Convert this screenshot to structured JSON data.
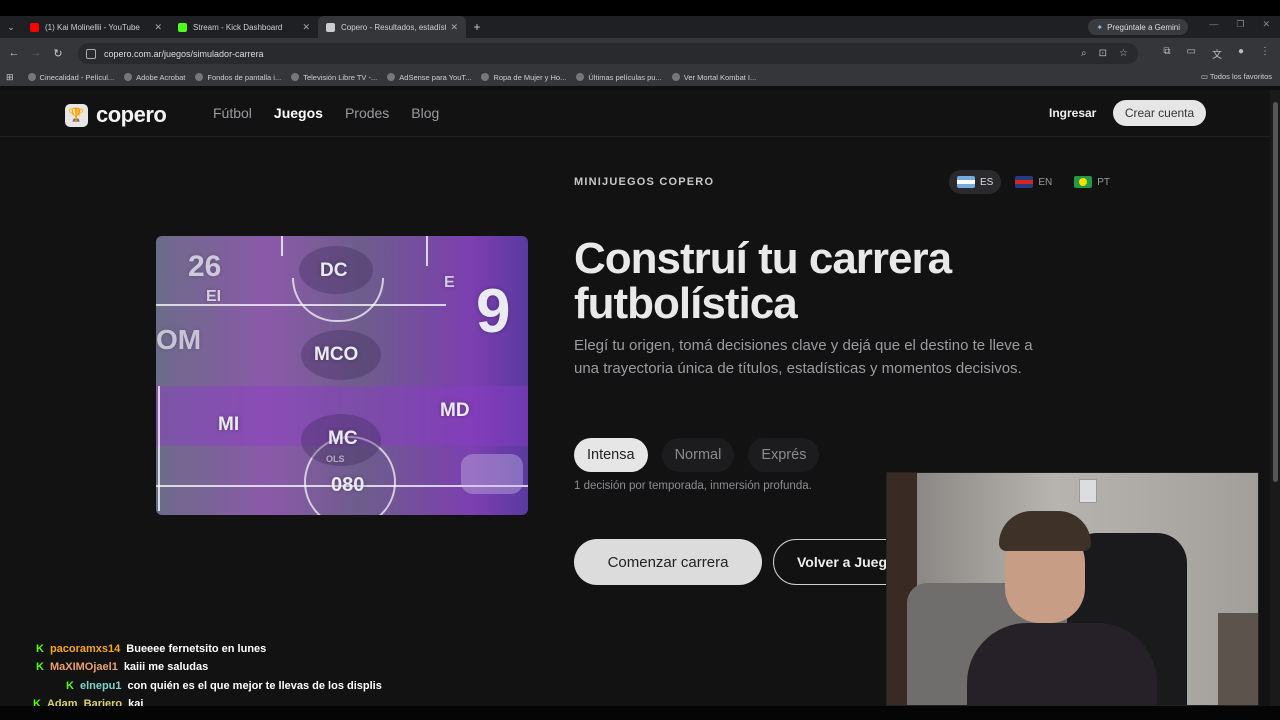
{
  "browser": {
    "tabs": [
      {
        "title": "(1) Kai Molinellii - YouTube",
        "icon": "youtube-icon",
        "color": "#ff0000"
      },
      {
        "title": "Stream - Kick Dashboard",
        "icon": "kick-icon",
        "color": "#53fc18"
      },
      {
        "title": "Copero - Resultados, estadístic",
        "icon": "copero-icon",
        "color": "#cccccc"
      }
    ],
    "gemini_label": "Pregúntale a Gemini",
    "url": "copero.com.ar/juegos/simulador-carrera",
    "bookmarks": [
      "Cinecalidad - Películ...",
      "Adobe Acrobat",
      "Fondos de pantalla i...",
      "Televisión Libre TV -...",
      "AdSense para YouT...",
      "Ropa de Mujer y Ho...",
      "Últimas películas pu...",
      "Ver Mortal Kombat I..."
    ],
    "all_bookmarks": "Todos los favoritos"
  },
  "site": {
    "logo": "copero",
    "nav": [
      "Fútbol",
      "Juegos",
      "Prodes",
      "Blog"
    ],
    "nav_current": "Juegos",
    "login": "Ingresar",
    "signup": "Crear cuenta"
  },
  "hero": {
    "eyebrow": "MINIJUEGOS COPERO",
    "languages": [
      {
        "code": "ES",
        "flag": "argentina-flag",
        "active": true
      },
      {
        "code": "EN",
        "flag": "uk-flag",
        "active": false
      },
      {
        "code": "PT",
        "flag": "brazil-flag",
        "active": false
      }
    ],
    "title": "Construí tu carrera futbolística",
    "description": "Elegí tu origen, tomá decisiones clave y dejá que el destino te lleve a una trayectoria única de títulos, estadísticas y momentos decisivos.",
    "modes": [
      "Intensa",
      "Normal",
      "Exprés"
    ],
    "selected_mode": "Intensa",
    "mode_hint": "1 decisión por temporada, inmersión profunda.",
    "start_button": "Comenzar carrera",
    "back_button": "Volver a Juegos",
    "image_positions": [
      "DC",
      "MCO",
      "MI",
      "MC",
      "MD",
      "26",
      "9",
      "080",
      "OLS",
      "EI",
      "E",
      "OM"
    ]
  },
  "chat": [
    {
      "user": "pacoramxs14",
      "text": "Bueeee fernetsito en lunes",
      "color": "#f5a623"
    },
    {
      "user": "MaXIMOjael1",
      "text": "kaiii me saludas",
      "color": "#e8a070"
    },
    {
      "user": "elnepu1",
      "text": "con quién es el que mejor te llevas de los displis",
      "color": "#7fd4c8"
    },
    {
      "user": "Adam_Bariero",
      "text": "kai",
      "color": "#d8d070"
    }
  ]
}
